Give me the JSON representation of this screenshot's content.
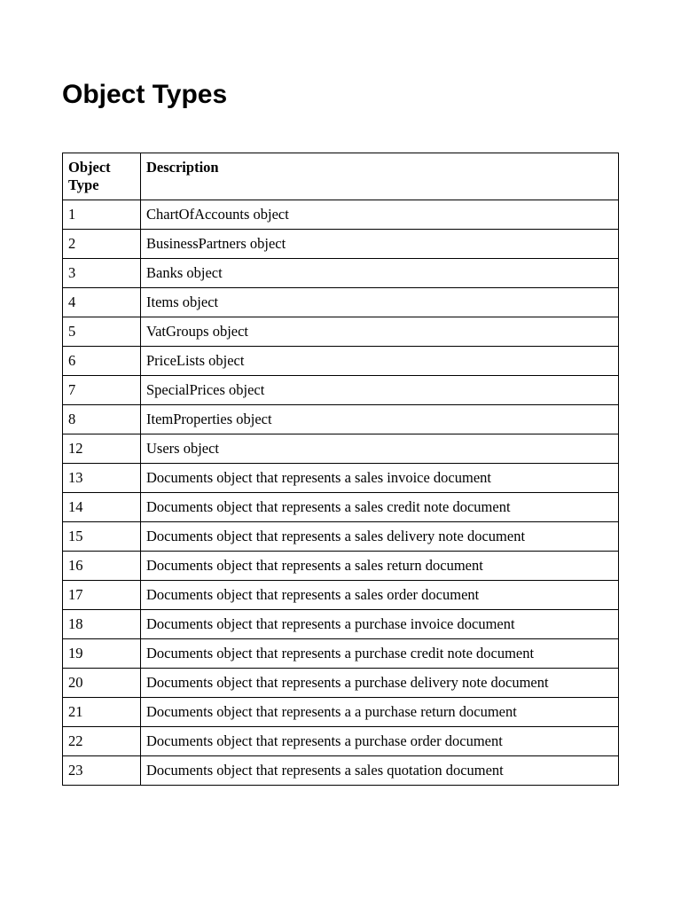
{
  "title": "Object Types",
  "table": {
    "headers": {
      "col1": "Object Type",
      "col2": "Description"
    },
    "rows": [
      {
        "type": "1",
        "desc": "ChartOfAccounts object"
      },
      {
        "type": "2",
        "desc": "BusinessPartners object"
      },
      {
        "type": "3",
        "desc": "Banks object"
      },
      {
        "type": "4",
        "desc": "Items object"
      },
      {
        "type": "5",
        "desc": "VatGroups object"
      },
      {
        "type": "6",
        "desc": "PriceLists object"
      },
      {
        "type": "7",
        "desc": "SpecialPrices object"
      },
      {
        "type": "8",
        "desc": "ItemProperties object"
      },
      {
        "type": "12",
        "desc": "Users object"
      },
      {
        "type": "13",
        "desc": "Documents object that represents a sales invoice document"
      },
      {
        "type": "14",
        "desc": "Documents object that represents a sales credit note document"
      },
      {
        "type": "15",
        "desc": "Documents object that represents a sales delivery note document"
      },
      {
        "type": "16",
        "desc": "Documents object that represents a sales return document"
      },
      {
        "type": "17",
        "desc": "Documents object that represents a sales order document"
      },
      {
        "type": "18",
        "desc": "Documents object that represents a purchase invoice document"
      },
      {
        "type": "19",
        "desc": "Documents object that represents a purchase credit note document"
      },
      {
        "type": "20",
        "desc": "Documents object that represents a purchase delivery note document"
      },
      {
        "type": "21",
        "desc": "Documents object that represents a a purchase return document"
      },
      {
        "type": "22",
        "desc": "Documents object that represents a purchase order document"
      },
      {
        "type": "23",
        "desc": "Documents object that represents a sales quotation document"
      }
    ]
  }
}
